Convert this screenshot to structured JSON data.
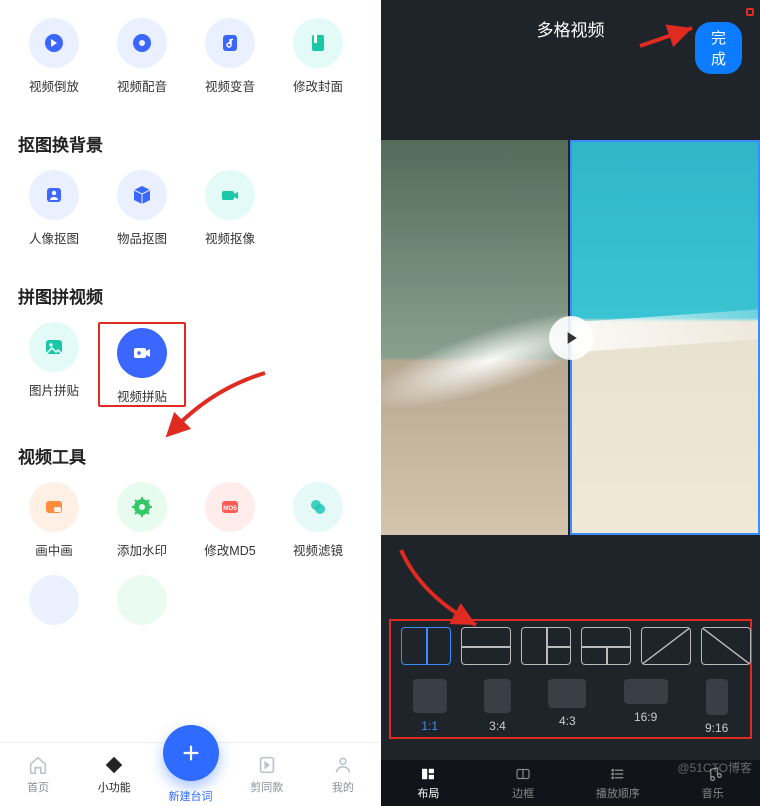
{
  "left": {
    "rows_top": [
      {
        "label": "视频倒放",
        "name": "reverse-video"
      },
      {
        "label": "视频配音",
        "name": "video-dub"
      },
      {
        "label": "视频变音",
        "name": "video-voice-change"
      },
      {
        "label": "修改封面",
        "name": "edit-cover"
      }
    ],
    "section_bg": {
      "title": "抠图换背景",
      "items": [
        {
          "label": "人像抠图",
          "name": "portrait-cutout"
        },
        {
          "label": "物品抠图",
          "name": "object-cutout"
        },
        {
          "label": "视频抠像",
          "name": "video-matting"
        }
      ]
    },
    "section_collage": {
      "title": "拼图拼视频",
      "items": [
        {
          "label": "图片拼贴",
          "name": "image-collage"
        },
        {
          "label": "视频拼贴",
          "name": "video-collage"
        }
      ]
    },
    "section_tools": {
      "title": "视频工具",
      "items": [
        {
          "label": "画中画",
          "name": "pip"
        },
        {
          "label": "添加水印",
          "name": "add-watermark"
        },
        {
          "label": "修改MD5",
          "name": "modify-md5"
        },
        {
          "label": "视频滤镜",
          "name": "video-filter"
        }
      ]
    },
    "bottom_nav": {
      "home": "首页",
      "functions": "小功能",
      "create": "新建台词",
      "cut_same": "剪同款",
      "mine": "我的"
    }
  },
  "right": {
    "title": "多格视频",
    "done": "完成",
    "ratios": [
      "1:1",
      "3:4",
      "4:3",
      "16:9",
      "9:16"
    ],
    "bottom_tabs": {
      "layout": "布局",
      "border": "边框",
      "play_order": "播放顺序",
      "music": "音乐"
    },
    "watermark": "@51CTO博客"
  }
}
